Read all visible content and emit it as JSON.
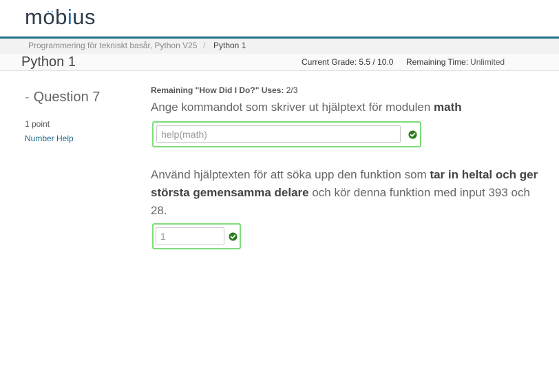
{
  "brand": {
    "logo_m": "m",
    "logo_o1": "o",
    "logo_umlaut": "··",
    "logo_b": "b",
    "logo_i": "i",
    "logo_o2": "o",
    "logo_rest": "us"
  },
  "breadcrumb": {
    "course": "Programmering för tekniskt basår, Python V25",
    "separator": "/",
    "current": "Python 1"
  },
  "assignment": {
    "title": "Python 1",
    "grade_label": "Current Grade:",
    "grade_value": "5.5 / 10.0",
    "time_label": "Remaining Time:",
    "time_value": "Unlimited"
  },
  "question": {
    "dash": "-",
    "number_label": "Question 7",
    "points": "1 point",
    "number_help": "Number Help",
    "hdid_label": "Remaining \"How Did I Do?\" Uses:",
    "hdid_value": "2/3",
    "part1": {
      "text": "Ange kommandot som skriver ut hjälptext för modulen ",
      "bold": "math",
      "answer": "help(math)"
    },
    "part2": {
      "text_a": "Använd hjälptexten för att söka upp den funktion som ",
      "bold": "tar in heltal och ger största gemensamma delare",
      "text_b": " och kör denna funktion med input 393 och 28.",
      "answer": "1"
    }
  },
  "icons": {
    "check": "checkmark-circle-icon"
  },
  "colors": {
    "accent": "#1f6f86",
    "logo_blue": "#1f6fb1",
    "correct_border": "#7fdc7a",
    "check_green": "#2e7d1f"
  }
}
